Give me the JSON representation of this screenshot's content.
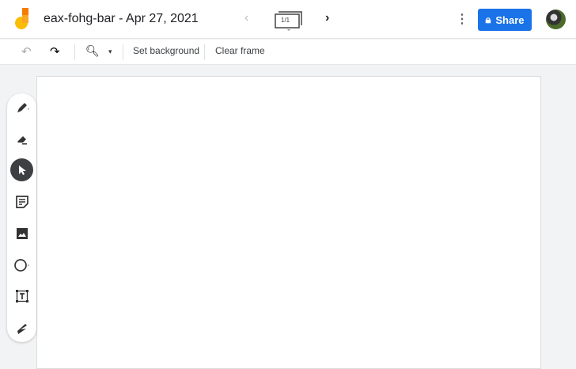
{
  "header": {
    "title": "eax-fohg-bar - Apr 27, 2021",
    "frame_counter": "1/1",
    "share_label": "Share"
  },
  "toolbar": {
    "set_background": "Set background",
    "clear_frame": "Clear frame"
  },
  "tools": [
    "pen",
    "eraser",
    "select",
    "sticky-note",
    "image",
    "circle",
    "text-box",
    "laser"
  ],
  "colors": {
    "accent": "#1a73e8",
    "selected_tool": "#3c4043"
  }
}
